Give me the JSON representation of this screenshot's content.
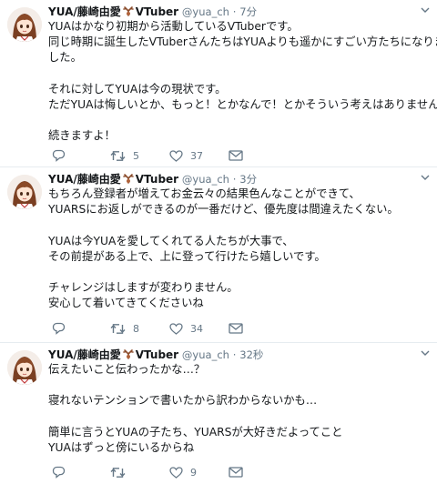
{
  "tweets": [
    {
      "name": "YUA/藤崎由愛",
      "handle_suffix": "VTuber",
      "handle": "@yua_ch",
      "time": "7分",
      "lines": [
        "YUAはかなり初期から活動しているVTuberです。",
        "同じ時期に誕生したVTuberさんたちはYUAよりも遥かにすごい方たちになりま",
        "した。",
        "",
        "それに対してYUAは今の現状です。",
        "ただYUAは悔しいとか、もっと！とかなんで！とかそういう考えはありません。",
        "",
        "続きますよ！"
      ],
      "retweets": "5",
      "likes": "37",
      "replies": ""
    },
    {
      "name": "YUA/藤崎由愛",
      "handle_suffix": "VTuber",
      "handle": "@yua_ch",
      "time": "3分",
      "lines": [
        "もちろん登録者が増えてお金云々の結果色んなことができて、",
        "YUARSにお返しができるのが一番だけど、優先度は間違えたくない。",
        "",
        "YUAは今YUAを愛してくれてる人たちが大事で、",
        "その前提がある上で、上に登って行けたら嬉しいです。",
        "",
        "チャレンジはしますが変わりません。",
        "安心して着いてきてくださいね"
      ],
      "retweets": "8",
      "likes": "34",
      "replies": ""
    },
    {
      "name": "YUA/藤崎由愛",
      "handle_suffix": "VTuber",
      "handle": "@yua_ch",
      "time": "32秒",
      "lines": [
        "伝えたいこと伝わったかな…？",
        "",
        "寝れないテンションで書いたから訳わからないかも…",
        "",
        "簡単に言うとYUAの子たち、YUARSが大好きだよってこと",
        "YUAはずっと傍にいるからね"
      ],
      "retweets": "",
      "likes": "9",
      "replies": ""
    }
  ],
  "icons": {
    "reply": "reply-icon",
    "retweet": "retweet-icon",
    "like": "heart-icon",
    "dm": "envelope-icon",
    "more": "chevron-down-icon",
    "badge": "antlers-emoji"
  },
  "colors": {
    "text": "#14171a",
    "muted": "#657786",
    "divider": "#e6ecf0",
    "antler": "#8a4b2a"
  }
}
